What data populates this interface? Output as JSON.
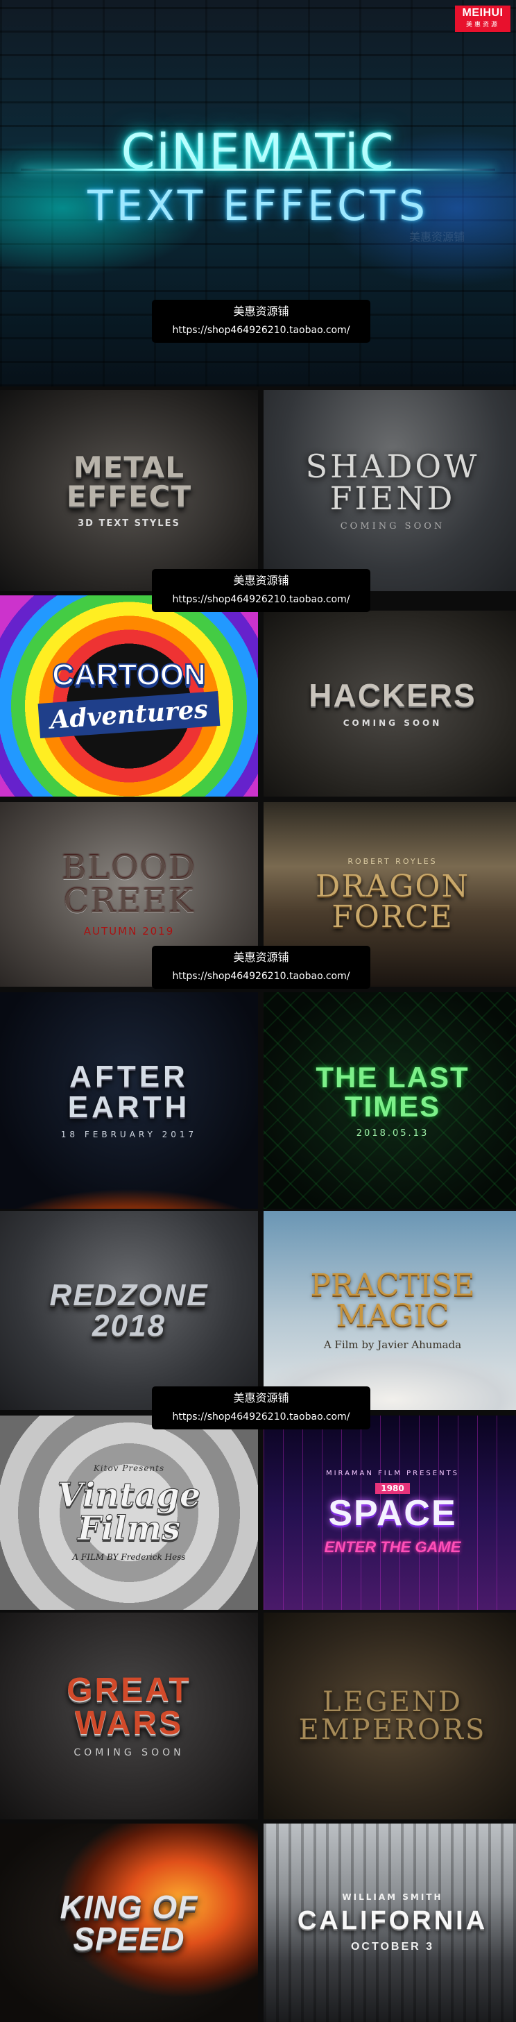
{
  "brand": {
    "logo": "MEIHUI",
    "logo_sub": "美惠资源"
  },
  "hero": {
    "line1": "CiNEMATiC",
    "line2": "TEXT EFFECTS",
    "watermark": "美惠资源铺"
  },
  "shop": {
    "name": "美惠资源铺",
    "url": "https://shop464926210.taobao.com/"
  },
  "tiles": [
    {
      "title": "METAL EFFECT",
      "sub": "3D TEXT STYLES"
    },
    {
      "title": "SHADOW FIEND",
      "sub": "COMING SOON"
    },
    {
      "title": "CARTOON",
      "sub": "Adventures"
    },
    {
      "title": "HACKERS",
      "sub": "COMING SOON"
    },
    {
      "title": "BLOOD CREEK",
      "sub": "AUTUMN 2019"
    },
    {
      "pre": "ROBERT ROYLES",
      "title": "DRAGON FORCE",
      "sub": ""
    },
    {
      "title": "AFTER EARTH",
      "sub": "18 FEBRUARY 2017"
    },
    {
      "title": "THE LAST TIMES",
      "sub": "2018.05.13"
    },
    {
      "title": "REDZONE 2018",
      "sub": ""
    },
    {
      "title": "PRACTISE MAGIC",
      "sub": "A Film by Javier Ahumada"
    },
    {
      "pre": "Kitov Presents",
      "title": "Vintage Films",
      "sub": "A FILM BY Frederick Hess"
    },
    {
      "pre": "MIRAMAN FILM PRESENTS",
      "tag": "1980",
      "title": "SPACE",
      "sub": "ENTER THE GAME"
    },
    {
      "title": "GREAT WARS",
      "sub": "COMING SOON"
    },
    {
      "title": "LEGEND EMPERORS",
      "sub": ""
    },
    {
      "title": "KING OF SPEED",
      "sub": ""
    },
    {
      "pre": "WILLIAM SMITH",
      "title": "CALIFORNIA",
      "sub": "OCTOBER 3"
    }
  ]
}
